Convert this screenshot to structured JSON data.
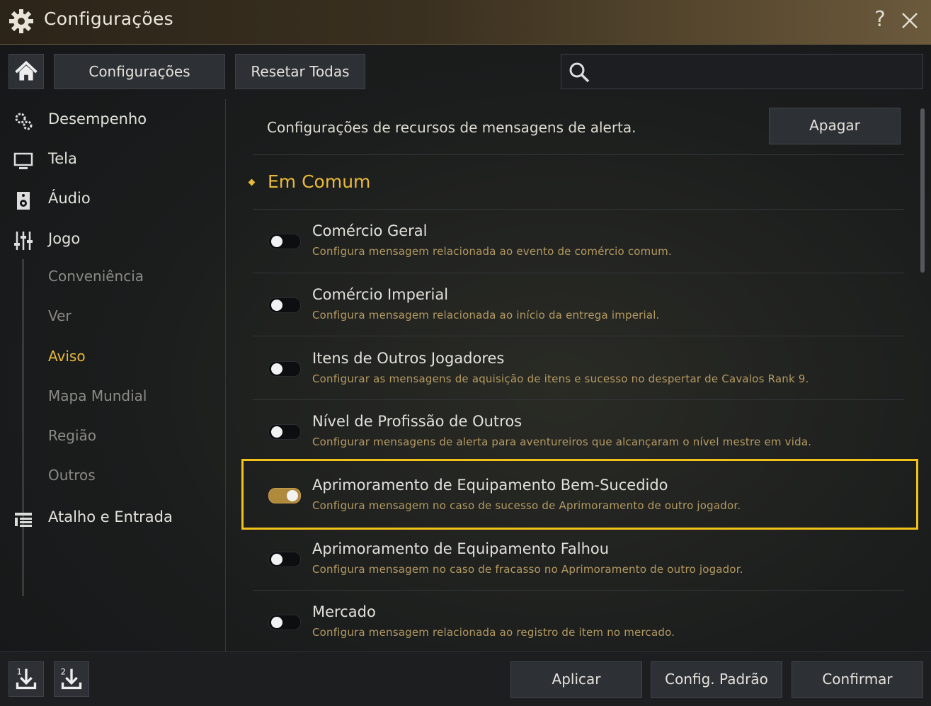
{
  "window": {
    "title": "Configurações",
    "help_label": "?"
  },
  "toolbar": {
    "config_label": "Configurações",
    "reset_label": "Resetar Todas",
    "search_placeholder": ""
  },
  "sidebar": {
    "items": [
      {
        "label": "Desempenho",
        "icon": "performance-gears-icon"
      },
      {
        "label": "Tela",
        "icon": "monitor-icon"
      },
      {
        "label": "Áudio",
        "icon": "speaker-icon"
      },
      {
        "label": "Jogo",
        "icon": "sliders-icon"
      },
      {
        "label": "Atalho e Entrada",
        "icon": "shortcut-list-icon"
      }
    ],
    "sub_items": [
      {
        "label": "Conveniência",
        "active": false
      },
      {
        "label": "Ver",
        "active": false
      },
      {
        "label": "Aviso",
        "active": true
      },
      {
        "label": "Mapa Mundial",
        "active": false
      },
      {
        "label": "Região",
        "active": false
      },
      {
        "label": "Outros",
        "active": false
      }
    ]
  },
  "main": {
    "header": "Configurações de recursos de mensagens de alerta.",
    "clear_label": "Apagar",
    "section_title": "Em Comum",
    "options": [
      {
        "title": "Comércio Geral",
        "desc": "Configura mensagem relacionada ao evento de comércio comum.",
        "on": false
      },
      {
        "title": "Comércio Imperial",
        "desc": "Configura mensagem relacionada ao início da entrega imperial.",
        "on": false
      },
      {
        "title": "Itens de Outros Jogadores",
        "desc": "Configurar as mensagens de aquisição de itens e sucesso no despertar de Cavalos Rank 9.",
        "on": false
      },
      {
        "title": "Nível de Profissão de Outros",
        "desc": "Configurar mensagens de alerta para aventureiros que alcançaram o nível mestre em vida.",
        "on": false
      },
      {
        "title": "Aprimoramento de Equipamento Bem-Sucedido",
        "desc": "Configura mensagem no caso de sucesso de Aprimoramento de outro jogador.",
        "on": true
      },
      {
        "title": "Aprimoramento de Equipamento Falhou",
        "desc": "Configura mensagem no caso de fracasso no Aprimoramento de outro jogador.",
        "on": false
      },
      {
        "title": "Mercado",
        "desc": "Configura mensagem relacionada ao registro de item no mercado.",
        "on": false
      }
    ]
  },
  "footer": {
    "preset1_label": "1",
    "preset2_label": "2",
    "apply_label": "Aplicar",
    "default_label": "Config. Padrão",
    "confirm_label": "Confirmar"
  },
  "colors": {
    "accent": "#e8b93a",
    "highlight": "#f2c21b",
    "toggle_on": "#b08a3c"
  }
}
